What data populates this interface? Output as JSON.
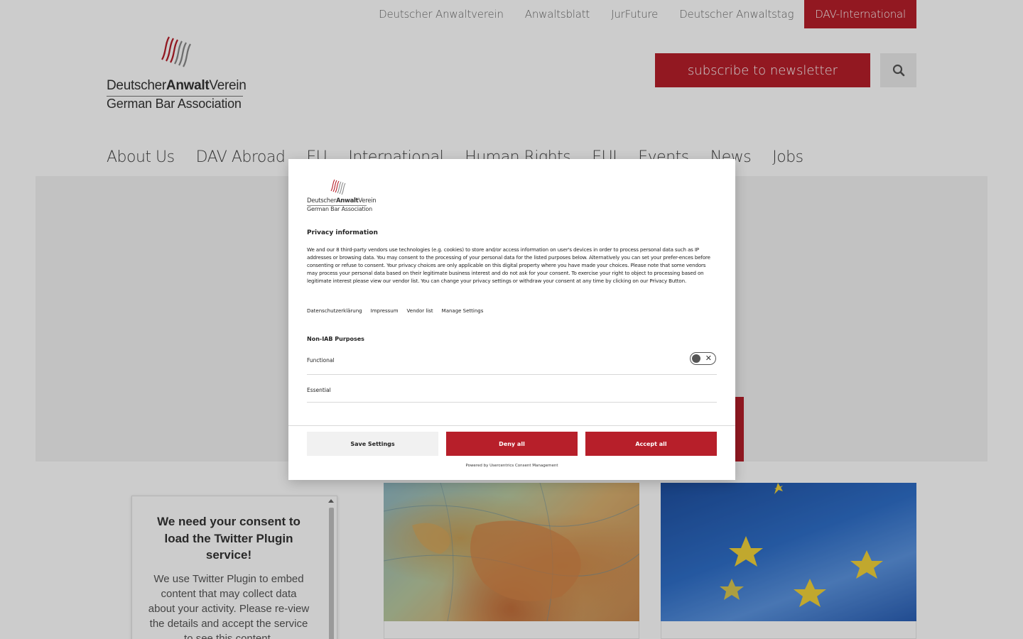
{
  "topbar": {
    "links": [
      "Deutscher Anwaltverein",
      "Anwaltsblatt",
      "JurFuture",
      "Deutscher Anwaltstag",
      "DAV-International"
    ]
  },
  "logo": {
    "line1_regular": "Deutscher",
    "line1_bold": "Anwalt",
    "line1_end": "Verein",
    "line2": "German Bar Association"
  },
  "header": {
    "newsletter_label": "subscribe to newsletter",
    "search_icon": "search-icon"
  },
  "nav": {
    "items": [
      "About Us",
      "DAV Abroad",
      "EU",
      "International",
      "Human Rights",
      "EUI",
      "Events",
      "News",
      "Jobs"
    ]
  },
  "twitter": {
    "title": "We need your consent to load the Twitter Plugin service!",
    "text": "We use Twitter Plugin to embed content that may collect data about your activity. Please re-view the details and accept the service to see this content."
  },
  "consent": {
    "title": "Privacy information",
    "description": "We and our 8 third-party vendors use technologies (e.g. cookies) to store and/or access information on user's devices in order to process personal data such as IP addresses or browsing data. You may consent to the processing of your personal data for the listed purposes below. Alternatively you can set your prefer-ences before consenting or refuse to consent. Your privacy choices are only applicable on this digital property where you have made your choices. Please note that some vendors may process your personal data based on their legitimate business interest and do not ask for your consent. To exercise your right to object to processing based on legitimate interest please view our vendor list. You can change your privacy settings or withdraw your consent at any time by clicking on our Privacy Button.",
    "links": [
      "Datenschutzerklärung",
      "Impressum",
      "Vendor list",
      "Manage Settings"
    ],
    "section_title": "Non-IAB Purposes",
    "purposes": [
      {
        "label": "Functional",
        "enabled": false
      },
      {
        "label": "Essential"
      }
    ],
    "buttons": {
      "save": "Save Settings",
      "deny": "Deny all",
      "accept": "Accept all"
    },
    "powered_by": "Powered by Usercentrics Consent Management"
  },
  "colors": {
    "brand_red": "#b71f2a",
    "overlay": "rgba(0,0,0,0.2)"
  }
}
